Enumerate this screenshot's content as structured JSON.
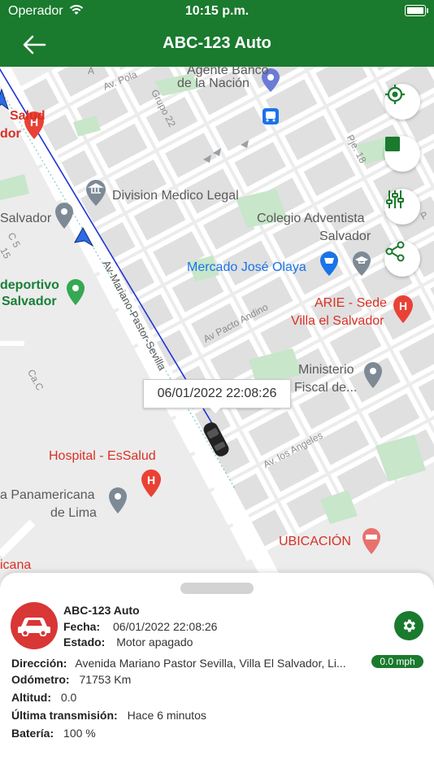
{
  "status_bar": {
    "carrier": "Operador",
    "time": "10:15 p.m."
  },
  "header": {
    "title": "ABC-123 Auto"
  },
  "map": {
    "labels": {
      "agente_banco_1": "Agente Banco",
      "agente_banco_2": "de la Nación",
      "salud_1": "Salud",
      "salud_2": "dor",
      "division_medico": "Division Medico Legal",
      "salvador_left": "Salvador",
      "colegio_1": "Colegio Adventista",
      "colegio_2": "Salvador",
      "mercado": "Mercado José Olaya",
      "deportivo_1": "deportivo",
      "deportivo_2": "Salvador",
      "arie_1": "ARIE - Sede",
      "arie_2": "Villa el Salvador",
      "ministerio_1": "Ministerio",
      "ministerio_2": "Fiscal de...",
      "hospital": "Hospital - EsSalud",
      "panamericana_1": "a Panamericana",
      "panamericana_2": "de Lima",
      "ubicacion": "UBICACIÓN",
      "icana": "icana",
      "street_av_pola": "Av. Pola",
      "street_grupo22": "Grupo 22",
      "street_mariano": "Av-Mariano-Pastor-Sevilla",
      "street_pacto": "Av Pacto Andino",
      "street_angeles": "Av. los Angeles",
      "street_cac": "Ca.C",
      "street_c5": "C 5",
      "street_15": "15",
      "street_pje18": "Pje. 18",
      "street_a": "A",
      "street_p": "P"
    },
    "tooltip": "06/01/2022 22:08:26",
    "controls": [
      "crosshair-icon",
      "stop-icon",
      "sliders-icon",
      "share-icon"
    ]
  },
  "vehicle": {
    "name": "ABC-123 Auto",
    "fecha_label": "Fecha:",
    "fecha": "06/01/2022 22:08:26",
    "estado_label": "Estado:",
    "estado": "Motor apagado",
    "direccion_label": "Dirección:",
    "direccion": "Avenida Mariano Pastor Sevilla, Villa El Salvador, Li...",
    "speed": "0.0 mph",
    "odometro_label": "Odómetro:",
    "odometro": "71753 Km",
    "altitud_label": "Altitud:",
    "altitud": "0.0",
    "ultima_label": "Última transmisión:",
    "ultima": "Hace 6 minutos",
    "bateria_label": "Batería:",
    "bateria": "100 %"
  },
  "colors": {
    "primary": "#1a7a2e",
    "avatar": "#d93636",
    "route": "#1f33d6",
    "poi_red": "#d93025",
    "poi_green": "#188038",
    "poi_blue": "#1a73e8"
  }
}
